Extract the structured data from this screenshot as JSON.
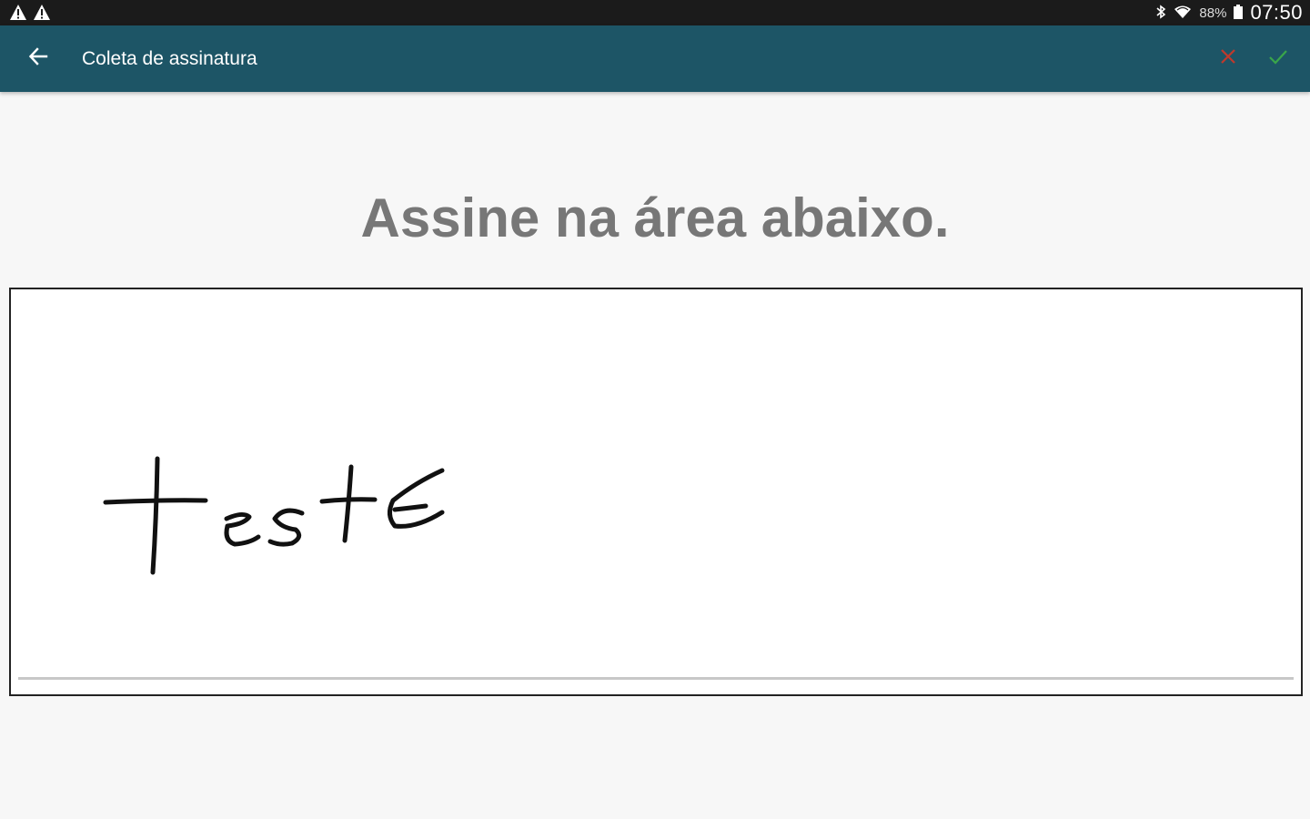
{
  "status_bar": {
    "left_icons": [
      "warning-icon",
      "warning-icon"
    ],
    "right_icons": [
      "bluetooth-icon",
      "wifi-icon",
      "battery-icon"
    ],
    "battery": "88%",
    "time": "07:50"
  },
  "app_bar": {
    "title": "Coleta de assinatura",
    "back_icon": "arrow-back-icon",
    "cancel_icon": "close-icon",
    "confirm_icon": "check-icon"
  },
  "main": {
    "instruction": "Assine na área abaixo."
  },
  "signature": {
    "handwritten_text": "teste"
  },
  "colors": {
    "status_bar": "#1b1b1b",
    "app_bar": "#1d5566",
    "cancel": "#c0392b",
    "confirm": "#3aa54a",
    "instruction_text": "#777777",
    "background": "#f7f7f7"
  }
}
